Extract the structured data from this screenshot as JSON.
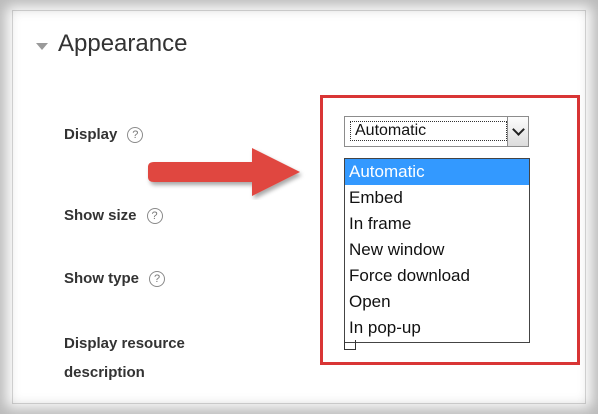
{
  "section": {
    "title": "Appearance",
    "caret_icon": "caret-down-icon"
  },
  "fields": [
    {
      "label": "Display",
      "help": "?"
    },
    {
      "label": "Show size",
      "help": "?"
    },
    {
      "label": "Show type",
      "help": "?"
    },
    {
      "label_line1": "Display resource",
      "label_line2": "description"
    }
  ],
  "select": {
    "value": "Automatic"
  },
  "dropdown": {
    "options": [
      "Automatic",
      "Embed",
      "In frame",
      "New window",
      "Force download",
      "Open",
      "In pop-up"
    ],
    "selected_index": 0
  },
  "colors": {
    "highlight": "#d93535",
    "selected_option": "#3399ff",
    "arrow": "#e0473f"
  }
}
